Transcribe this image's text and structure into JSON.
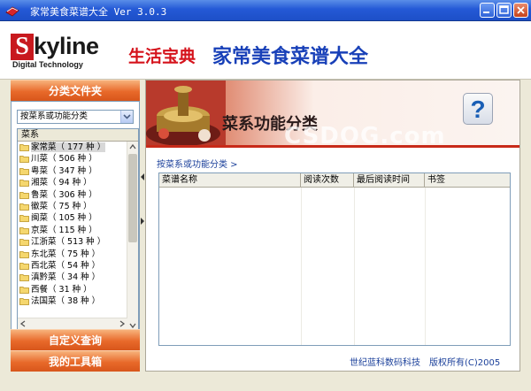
{
  "window": {
    "title": "家常美食菜谱大全 Ver 3.0.3",
    "buttons": {
      "minimize": "minimize-icon",
      "maximize": "maximize-icon",
      "close": "close-icon"
    }
  },
  "header": {
    "logo_word": "kyline",
    "logo_letter": "S",
    "logo_sub": "Digital Technology",
    "slogan_red": "生活宝典",
    "slogan_blue": "家常美食菜谱大全"
  },
  "sidebar": {
    "section_title": "分类文件夹",
    "dropdown_value": "按菜系或功能分类",
    "tree_header": "菜系",
    "items": [
      {
        "label": "家常菜（ 177 种 ）"
      },
      {
        "label": "川菜（ 506 种 ）"
      },
      {
        "label": "粤菜（ 347 种 ）"
      },
      {
        "label": "湘菜（ 94 种 ）"
      },
      {
        "label": "鲁菜（ 306 种 ）"
      },
      {
        "label": "徽菜（ 75 种 ）"
      },
      {
        "label": "闽菜（ 105 种 ）"
      },
      {
        "label": "京菜（ 115 种 ）"
      },
      {
        "label": "江浙菜（ 513 种 ）"
      },
      {
        "label": "东北菜（ 75 种 ）"
      },
      {
        "label": "西北菜（ 54 种 ）"
      },
      {
        "label": "滇黔菜（ 34 种 ）"
      },
      {
        "label": "西餐（ 31 种 ）"
      },
      {
        "label": "法国菜（ 38 种 ）"
      }
    ],
    "custom_query": "自定义查询",
    "toolbox": "我的工具箱"
  },
  "main": {
    "banner_title": "菜系功能分类",
    "watermark": "CSDOG.com",
    "help_label": "?",
    "breadcrumb": "按菜系或功能分类 >",
    "columns": [
      "菜谱名称",
      "阅读次数",
      "最后阅读时间",
      "书签"
    ],
    "footer": "世纪蓝科数码科技　版权所有(C)2005"
  },
  "colors": {
    "titlebar": "#2459d6",
    "accent_orange": "#e8692a",
    "brand_red": "#d5121b",
    "brand_blue": "#1840b8"
  }
}
